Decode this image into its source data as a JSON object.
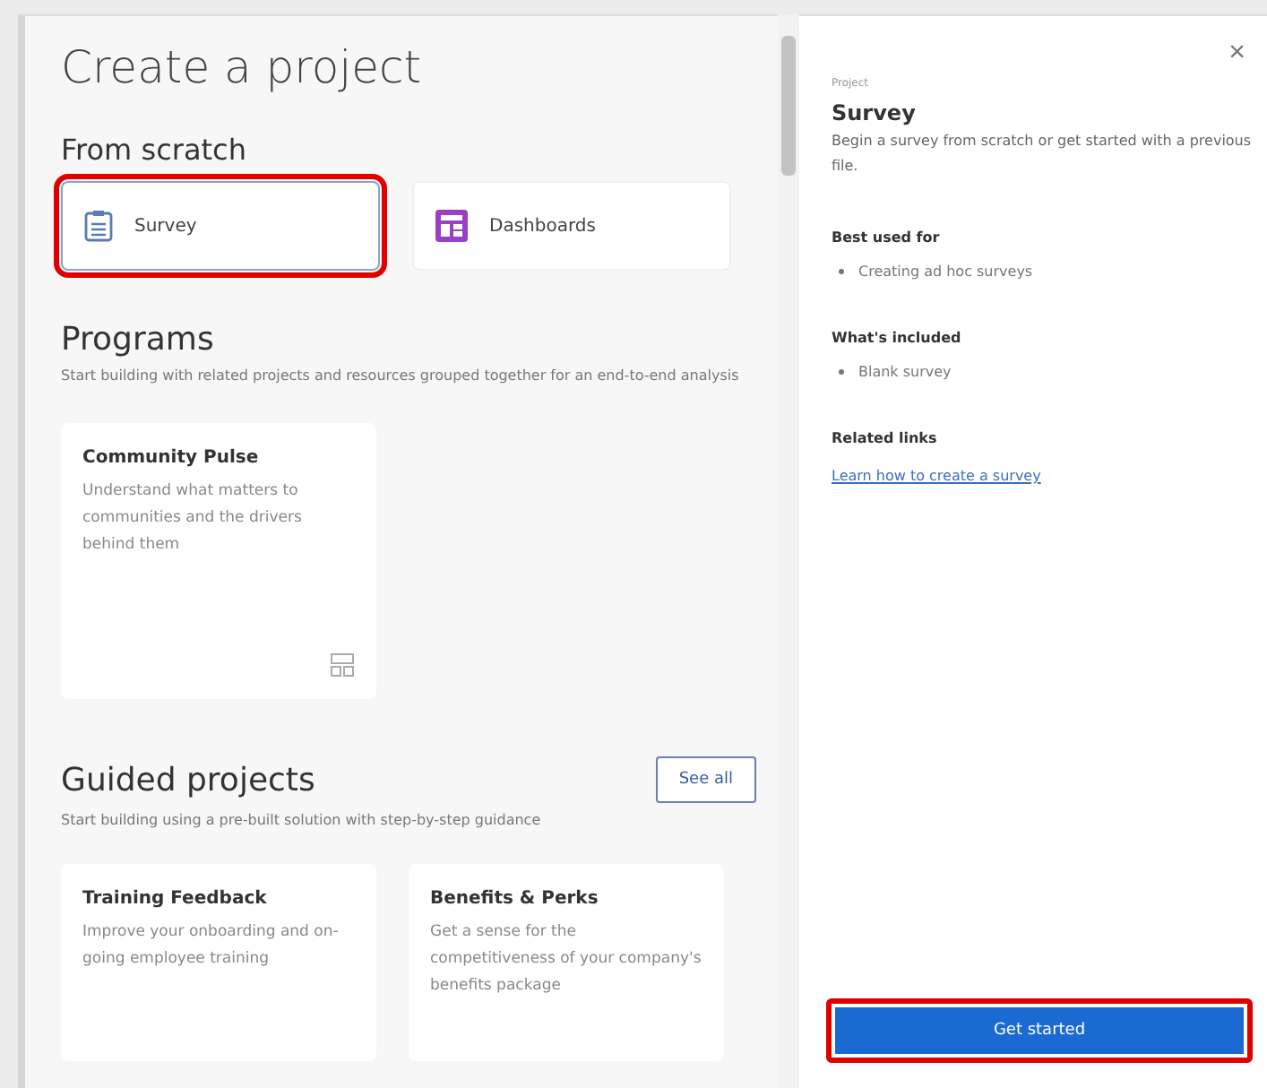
{
  "title": "Create a project",
  "from_scratch": {
    "heading": "From scratch",
    "items": [
      {
        "label": "Survey",
        "kind": "clipboard",
        "selected": true,
        "highlighted": true
      },
      {
        "label": "Dashboards",
        "kind": "dashboard",
        "selected": false,
        "highlighted": false
      }
    ]
  },
  "programs": {
    "heading": "Programs",
    "description": "Start building with related projects and resources grouped together for an end-to-end analysis",
    "cards": [
      {
        "title": "Community Pulse",
        "description": "Understand what matters to communities and the drivers behind them"
      }
    ]
  },
  "guided_projects": {
    "heading": "Guided projects",
    "see_all": "See all",
    "description": "Start building using a pre-built solution with step-by-step guidance",
    "cards": [
      {
        "title": "Training Feedback",
        "description": "Improve your onboarding and on-going employee training"
      },
      {
        "title": "Benefits & Perks",
        "description": "Get a sense for the competitiveness of your company's benefits package"
      }
    ]
  },
  "details": {
    "close": "×",
    "label": "Project",
    "title": "Survey",
    "description": "Begin a survey from scratch or get started with a previous file.",
    "sections": [
      {
        "heading": "Best used for",
        "bullets": [
          "Creating ad hoc surveys"
        ]
      },
      {
        "heading": "What's included",
        "bullets": [
          "Blank survey"
        ]
      },
      {
        "heading": "Related links",
        "links": [
          "Learn how to create a survey"
        ]
      }
    ],
    "button": {
      "label": "Get started",
      "highlighted": true
    }
  }
}
